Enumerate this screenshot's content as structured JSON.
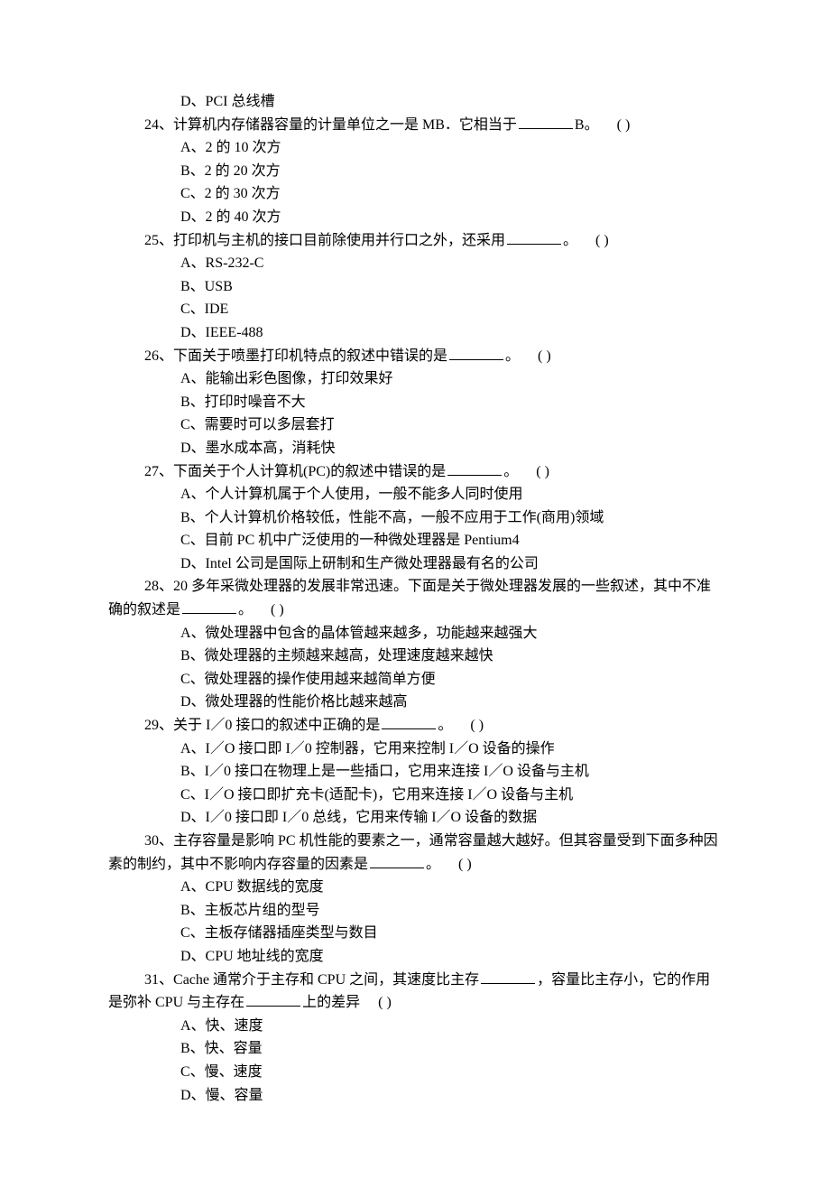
{
  "questions": [
    {
      "pre_option": "D、PCI 总线槽"
    },
    {
      "num": "24、",
      "text_before": "计算机内存储器容量的计量单位之一是 MB．它相当于",
      "text_after": "B。",
      "paren": "(    )",
      "options": [
        "A、2 的 10 次方",
        "B、2 的 20 次方",
        "C、2 的 30 次方",
        "D、2 的 40 次方"
      ]
    },
    {
      "num": "25、",
      "text_before": "打印机与主机的接口目前除使用并行口之外，还采用",
      "text_after": "。",
      "paren": "(    )",
      "options": [
        "A、RS-232-C",
        "B、USB",
        "C、IDE",
        "D、IEEE-488"
      ]
    },
    {
      "num": "26、",
      "text_before": "下面关于喷墨打印机特点的叙述中错误的是",
      "text_after": "。",
      "paren": "(    )",
      "options": [
        "A、能输出彩色图像，打印效果好",
        "B、打印时噪音不大",
        "C、需要时可以多层套打",
        "D、墨水成本高，消耗快"
      ]
    },
    {
      "num": "27、",
      "text_before": "下面关于个人计算机(PC)的叙述中错误的是",
      "text_after": "。",
      "paren": "(    )",
      "options": [
        "A、个人计算机属于个人使用，一般不能多人同时使用",
        "B、个人计算机价格较低，性能不高，一般不应用于工作(商用)领域",
        "C、目前 PC 机中广泛使用的一种微处理器是 Pentium4",
        "D、Intel 公司是国际上研制和生产微处理器最有名的公司"
      ]
    },
    {
      "num": "28、",
      "full_text_1": "20 多年采微处理器的发展非常迅速。下面是关于微处理器发展的一些叙述，其中不准",
      "full_text_2a": "确的叙述是",
      "full_text_2b": "。",
      "paren": "(    )",
      "options": [
        "A、微处理器中包含的晶体管越来越多，功能越来越强大",
        "B、微处理器的主频越来越高，处理速度越来越快",
        "C、微处理器的操作使用越来越简单方便",
        "D、微处理器的性能价格比越来越高"
      ]
    },
    {
      "num": "29、",
      "text_before": "关于 I／0 接口的叙述中正确的是",
      "text_after": "。",
      "paren": "(    )",
      "options": [
        "A、I／O 接口即 I／0 控制器，它用来控制 I／O 设备的操作",
        "B、I／0 接口在物理上是一些插口，它用来连接 I／O 设备与主机",
        "C、I／O 接口即扩充卡(适配卡)，它用来连接 I／O 设备与主机",
        "D、I／0 接口即 I／0 总线，它用来传输 I／O 设备的数据"
      ]
    },
    {
      "num": "30、",
      "full_text_1": "主存容量是影响 PC 机性能的要素之一，通常容量越大越好。但其容量受到下面多种因",
      "full_text_2a": "素的制约，其中不影响内存容量的因素是",
      "full_text_2b": "。",
      "paren": "(    )",
      "options": [
        "A、CPU 数据线的宽度",
        "B、主板芯片组的型号",
        "C、主板存储器插座类型与数目",
        "D、CPU 地址线的宽度"
      ]
    },
    {
      "num": "31、",
      "full_text_1a": "Cache 通常介于主存和 CPU 之间，其速度比主存",
      "full_text_1b": "，容量比主存小，它的作用",
      "full_text_2a": "是弥补 CPU 与主存在",
      "full_text_2b": "上的差异",
      "paren": "(    )",
      "options": [
        "A、快、速度",
        "B、快、容量",
        "C、慢、速度",
        "D、慢、容量"
      ]
    }
  ]
}
